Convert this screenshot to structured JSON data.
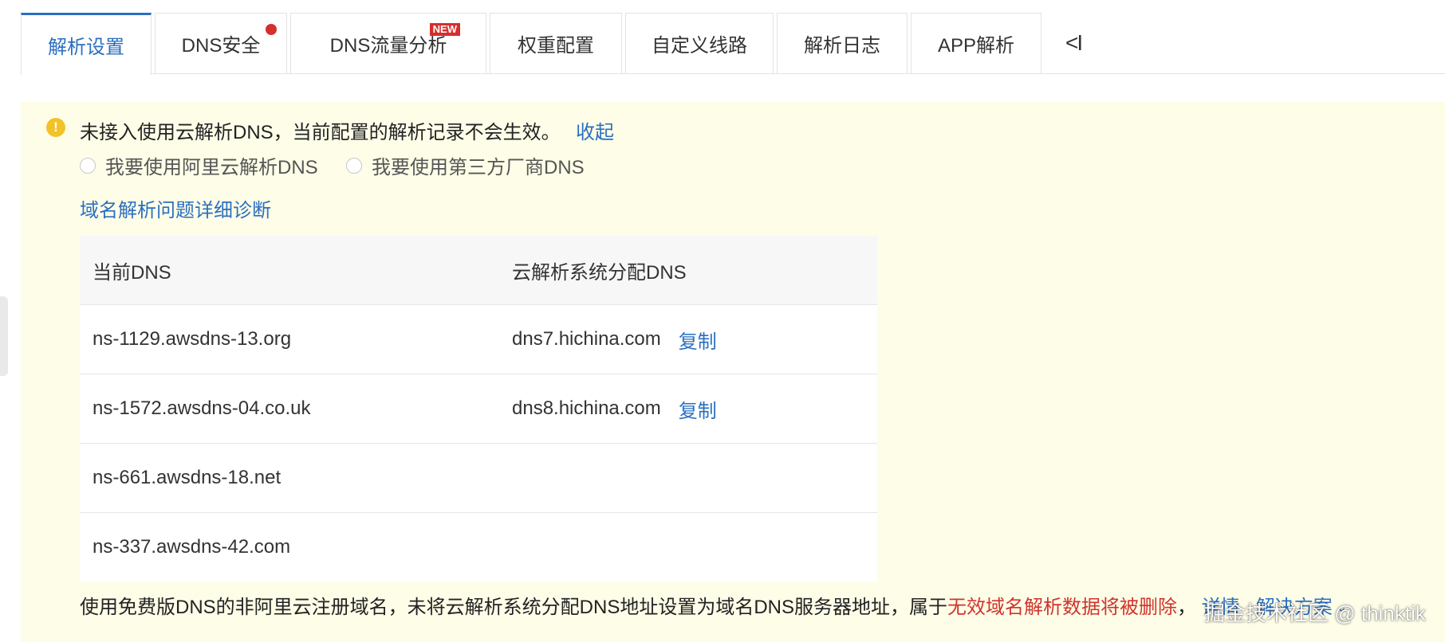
{
  "tabs": [
    {
      "label": "解析设置"
    },
    {
      "label": "DNS安全"
    },
    {
      "label": "DNS流量分析",
      "badge": "NEW"
    },
    {
      "label": "权重配置"
    },
    {
      "label": "自定义线路"
    },
    {
      "label": "解析日志"
    },
    {
      "label": "APP解析"
    }
  ],
  "tabbar": {
    "collapse_symbol": "<I"
  },
  "notice": {
    "message": "未接入使用云解析DNS，当前配置的解析记录不会生效。",
    "collapse_label": "收起",
    "radio_options": [
      "我要使用阿里云解析DNS",
      "我要使用第三方厂商DNS"
    ],
    "diagnose_link": "域名解析问题详细诊断"
  },
  "dns_table": {
    "headers": [
      "当前DNS",
      "云解析系统分配DNS"
    ],
    "copy_label": "复制",
    "rows": [
      {
        "current": "ns-1129.awsdns-13.org",
        "assigned": "dns7.hichina.com"
      },
      {
        "current": "ns-1572.awsdns-04.co.uk",
        "assigned": "dns8.hichina.com"
      },
      {
        "current": "ns-661.awsdns-18.net",
        "assigned": ""
      },
      {
        "current": "ns-337.awsdns-42.com",
        "assigned": ""
      }
    ]
  },
  "footer": {
    "text": "使用免费版DNS的非阿里云注册域名，未将云解析系统分配DNS地址设置为域名DNS服务器地址，属于",
    "warning": "无效域名解析数据将被删除",
    "comma": "，",
    "details_link": "详情",
    "solution_link": "解决方案"
  },
  "watermark": "掘金技术社区 @ thinktik",
  "colors": {
    "accent": "#2a6fc1",
    "warning_red": "#d0342b",
    "notice_bg": "#fefde8",
    "badge_red": "#d62d2d"
  },
  "icons": {
    "warning": "warning-icon",
    "chevron": "chevron-down-icon"
  }
}
